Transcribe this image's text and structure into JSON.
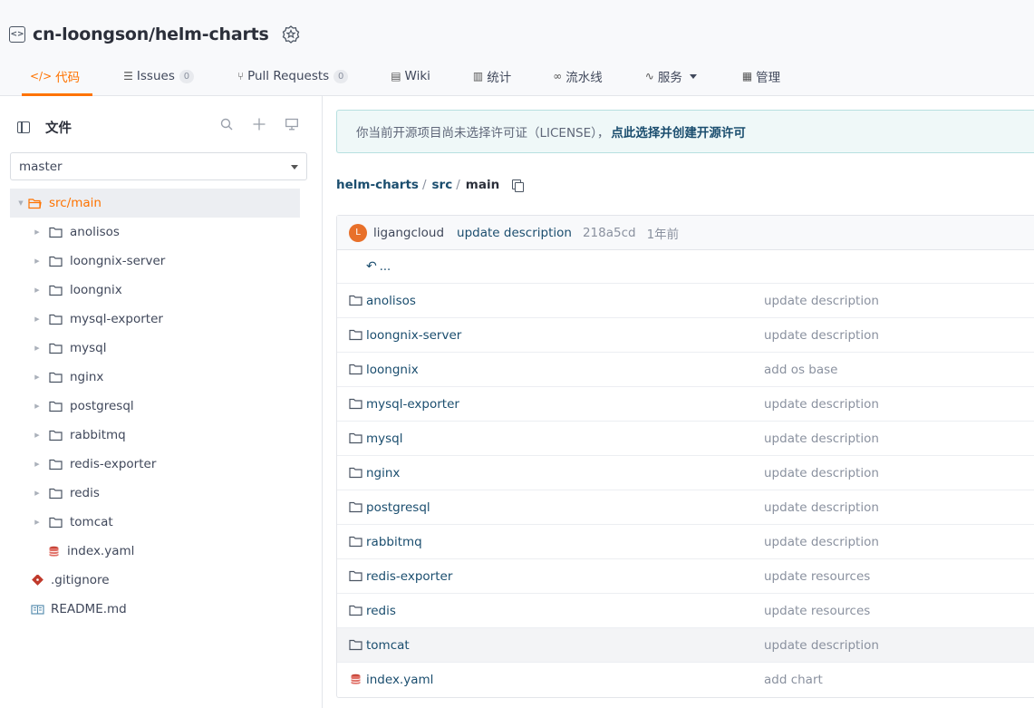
{
  "repo": {
    "name": "cn-loongson/helm-charts"
  },
  "tabs": [
    {
      "label": "代码",
      "icon": "code-icon"
    },
    {
      "label": "Issues",
      "count": "0",
      "icon": "issues-icon"
    },
    {
      "label": "Pull Requests",
      "count": "0",
      "icon": "pull-request-icon"
    },
    {
      "label": "Wiki",
      "icon": "wiki-icon"
    },
    {
      "label": "统计",
      "icon": "chart-icon"
    },
    {
      "label": "流水线",
      "icon": "pipeline-icon"
    },
    {
      "label": "服务",
      "icon": "pulse-icon"
    },
    {
      "label": "管理",
      "icon": "manage-icon"
    }
  ],
  "sidebar": {
    "title": "文件",
    "branch": "master",
    "root": "src/main",
    "folders": [
      "anolisos",
      "loongnix-server",
      "loongnix",
      "mysql-exporter",
      "mysql",
      "nginx",
      "postgresql",
      "rabbitmq",
      "redis-exporter",
      "redis",
      "tomcat"
    ],
    "root_file": "index.yaml",
    "top_files": [
      ".gitignore",
      "README.md"
    ]
  },
  "notice": {
    "text": "你当前开源项目尚未选择许可证（LICENSE），",
    "link": "点此选择并创建开源许可"
  },
  "breadcrumb": {
    "repo": "helm-charts",
    "sep": "/",
    "p1": "src",
    "p2": "main"
  },
  "commit": {
    "avatar": "L",
    "author": "ligangcloud",
    "message": "update description",
    "sha": "218a5cd",
    "time": "1年前"
  },
  "back": "...",
  "files": [
    {
      "name": "anolisos",
      "msg": "update description"
    },
    {
      "name": "loongnix-server",
      "msg": "update description"
    },
    {
      "name": "loongnix",
      "msg": "add os base"
    },
    {
      "name": "mysql-exporter",
      "msg": "update description"
    },
    {
      "name": "mysql",
      "msg": "update description"
    },
    {
      "name": "nginx",
      "msg": "update description"
    },
    {
      "name": "postgresql",
      "msg": "update description"
    },
    {
      "name": "rabbitmq",
      "msg": "update description"
    },
    {
      "name": "redis-exporter",
      "msg": "update resources"
    },
    {
      "name": "redis",
      "msg": "update resources"
    },
    {
      "name": "tomcat",
      "msg": "update description"
    },
    {
      "name": "index.yaml",
      "msg": "add chart"
    }
  ]
}
